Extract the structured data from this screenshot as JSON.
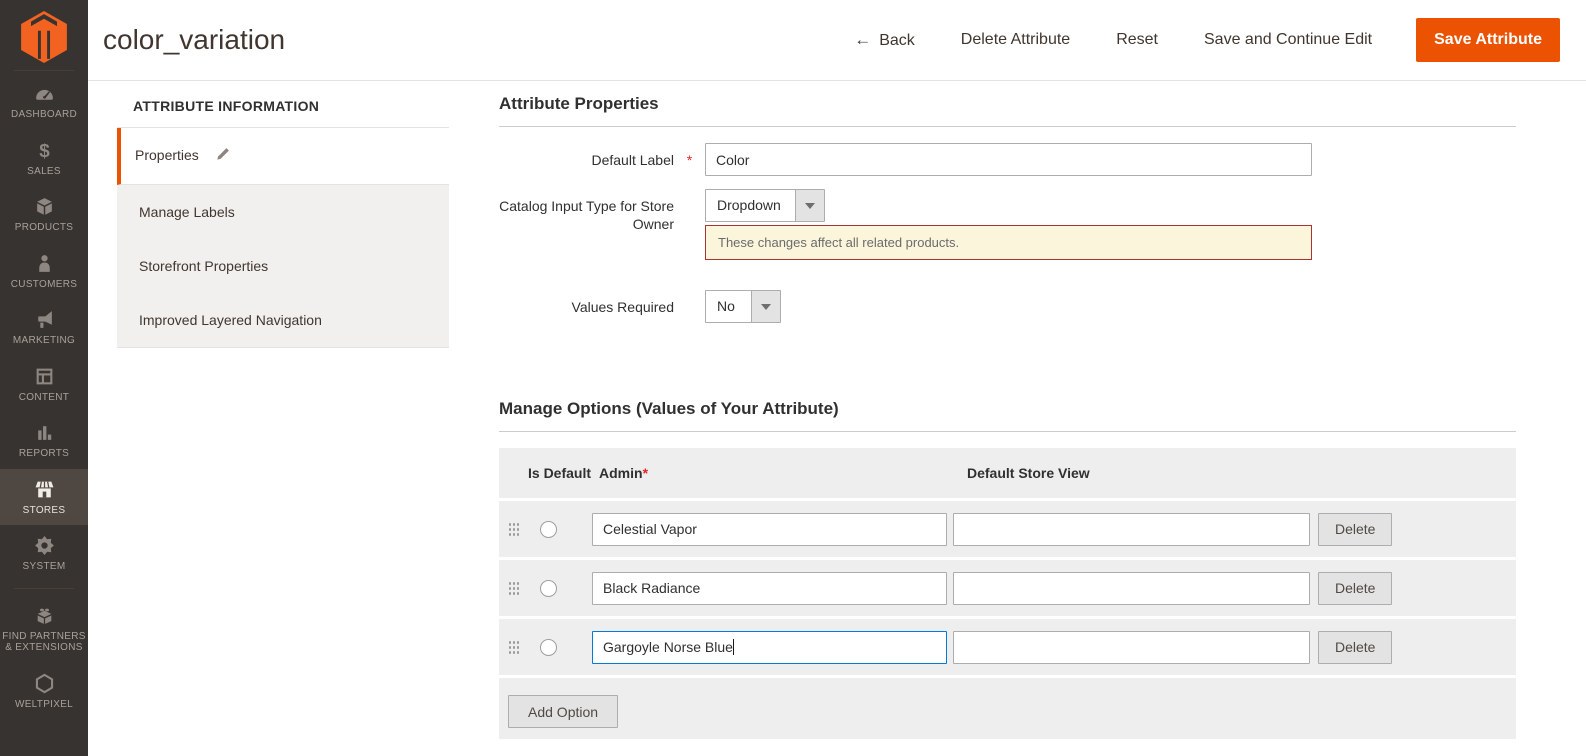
{
  "header": {
    "title": "color_variation",
    "actions": {
      "back": "Back",
      "delete_attribute": "Delete Attribute",
      "reset": "Reset",
      "save_and_continue": "Save and Continue Edit",
      "save_attribute": "Save Attribute"
    }
  },
  "sidebar": {
    "items": [
      {
        "label": "DASHBOARD",
        "icon": "dashboard-icon",
        "active": false
      },
      {
        "label": "SALES",
        "icon": "sales-icon",
        "active": false
      },
      {
        "label": "PRODUCTS",
        "icon": "products-icon",
        "active": false
      },
      {
        "label": "CUSTOMERS",
        "icon": "customers-icon",
        "active": false
      },
      {
        "label": "MARKETING",
        "icon": "marketing-icon",
        "active": false
      },
      {
        "label": "CONTENT",
        "icon": "content-icon",
        "active": false
      },
      {
        "label": "REPORTS",
        "icon": "reports-icon",
        "active": false
      },
      {
        "label": "STORES",
        "icon": "stores-icon",
        "active": true
      },
      {
        "label": "SYSTEM",
        "icon": "system-icon",
        "active": false
      },
      {
        "label": "FIND PARTNERS & EXTENSIONS",
        "icon": "find-partners-icon",
        "active": false
      },
      {
        "label": "WELTPIXEL",
        "icon": "weltpixel-icon",
        "active": false
      }
    ]
  },
  "tabs": {
    "title": "ATTRIBUTE INFORMATION",
    "items": [
      {
        "label": "Properties",
        "active": true
      },
      {
        "label": "Manage Labels",
        "active": false
      },
      {
        "label": "Storefront Properties",
        "active": false
      },
      {
        "label": "Improved Layered Navigation",
        "active": false
      }
    ]
  },
  "attribute_properties": {
    "title": "Attribute Properties",
    "default_label": {
      "label": "Default Label",
      "required": "*",
      "value": "Color"
    },
    "catalog_input_type": {
      "label": "Catalog Input Type for Store Owner",
      "value": "Dropdown",
      "notice": "These changes affect all related products."
    },
    "values_required": {
      "label": "Values Required",
      "value": "No"
    }
  },
  "manage_options": {
    "title": "Manage Options (Values of Your Attribute)",
    "columns": {
      "is_default": "Is Default",
      "admin": "Admin",
      "admin_required": "*",
      "default_store_view": "Default Store View"
    },
    "rows": [
      {
        "admin": "Celestial Vapor",
        "store_view": "",
        "delete": "Delete",
        "focused": false
      },
      {
        "admin": "Black Radiance",
        "store_view": "",
        "delete": "Delete",
        "focused": false
      },
      {
        "admin": "Gargoyle Norse Blue",
        "store_view": "",
        "delete": "Delete",
        "focused": true
      }
    ],
    "add_option": "Add Option"
  },
  "colors": {
    "accent_orange": "#eb5202",
    "logo_orange": "#f26322",
    "focus_blue": "#007bdb",
    "notice_bg": "#fbf5dc",
    "notice_border": "#aa3333",
    "sidebar_bg": "#373330",
    "sidebar_active_bg": "#4e4742"
  }
}
